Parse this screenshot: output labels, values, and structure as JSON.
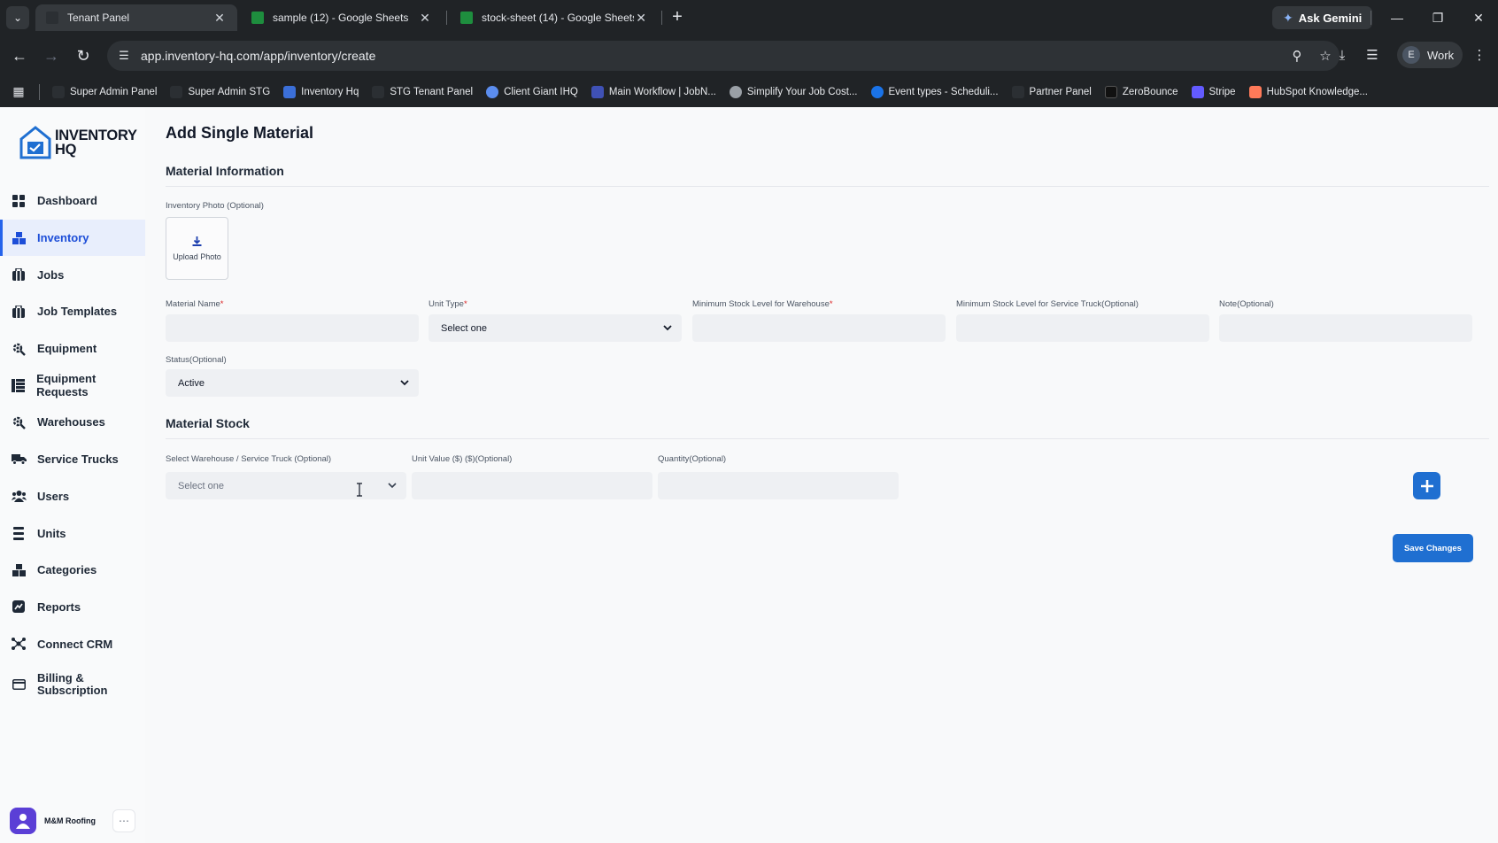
{
  "browser": {
    "tabs": [
      {
        "title": "Tenant Panel",
        "active": true
      },
      {
        "title": "sample (12) - Google Sheets",
        "active": false
      },
      {
        "title": "stock-sheet (14) - Google Sheets",
        "active": false
      }
    ],
    "url": "app.inventory-hq.com/app/inventory/create",
    "gemini_label": "Ask Gemini",
    "profile_initial": "E",
    "profile_name": "Work",
    "bookmarks": [
      {
        "label": "Super Admin Panel",
        "color": "#2b2f33"
      },
      {
        "label": "Super Admin STG",
        "color": "#2b2f33"
      },
      {
        "label": "Inventory Hq",
        "color": "#3b6fd8"
      },
      {
        "label": "STG Tenant Panel",
        "color": "#2b2f33"
      },
      {
        "label": "Client Giant IHQ",
        "color": "#5b8def"
      },
      {
        "label": "Main Workflow | JobN...",
        "color": "#3f51b5"
      },
      {
        "label": "Simplify Your Job Cost...",
        "color": "#9aa0a6"
      },
      {
        "label": "Event types - Scheduli...",
        "color": "#1a73e8"
      },
      {
        "label": "Partner Panel",
        "color": "#2b2f33"
      },
      {
        "label": "ZeroBounce",
        "color": "#111111"
      },
      {
        "label": "Stripe",
        "color": "#635bff"
      },
      {
        "label": "HubSpot Knowledge...",
        "color": "#ff7a59"
      }
    ]
  },
  "brand": {
    "line1": "INVENTORY",
    "line2": "HQ",
    "accent": "#1f6fd1"
  },
  "sidebar": {
    "items": [
      {
        "label": "Dashboard",
        "icon": "grid-icon"
      },
      {
        "label": "Inventory",
        "icon": "boxes-icon",
        "active": true
      },
      {
        "label": "Jobs",
        "icon": "briefcase-icon"
      },
      {
        "label": "Job Templates",
        "icon": "briefcase-icon"
      },
      {
        "label": "Equipment",
        "icon": "gear-wrench-icon"
      },
      {
        "label": "Equipment Requests",
        "icon": "list-icon"
      },
      {
        "label": "Warehouses",
        "icon": "gear-wrench-icon"
      },
      {
        "label": "Service Trucks",
        "icon": "truck-icon"
      },
      {
        "label": "Users",
        "icon": "users-icon"
      },
      {
        "label": "Units",
        "icon": "units-icon"
      },
      {
        "label": "Categories",
        "icon": "boxes-icon"
      },
      {
        "label": "Reports",
        "icon": "chart-icon"
      },
      {
        "label": "Connect CRM",
        "icon": "connect-icon"
      },
      {
        "label": "Billing &",
        "label2": "Subscription",
        "icon": "card-icon"
      }
    ],
    "user_name": "M&M Roofing",
    "user_more": "⋯"
  },
  "main": {
    "title": "Add Single Material",
    "section_info": "Material Information",
    "photo_label": "Inventory Photo (Optional)",
    "upload_label": "Upload Photo",
    "fields": {
      "material_name_label": "Material Name",
      "unit_type_label": "Unit Type",
      "unit_type_value": "Select one",
      "min_warehouse_label": "Minimum Stock Level for Warehouse",
      "min_truck_label": "Minimum Stock Level for Service Truck(Optional)",
      "note_label": "Note(Optional)",
      "status_label": "Status(Optional)",
      "status_value": "Active",
      "required_mark": "*"
    },
    "section_stock": "Material Stock",
    "stock": {
      "location_label": "Select Warehouse / Service Truck (Optional)",
      "location_value": "Select one",
      "unit_value_label": "Unit Value ($) ($)(Optional)",
      "quantity_label": "Quantity(Optional)"
    },
    "save_label": "Save Changes"
  }
}
